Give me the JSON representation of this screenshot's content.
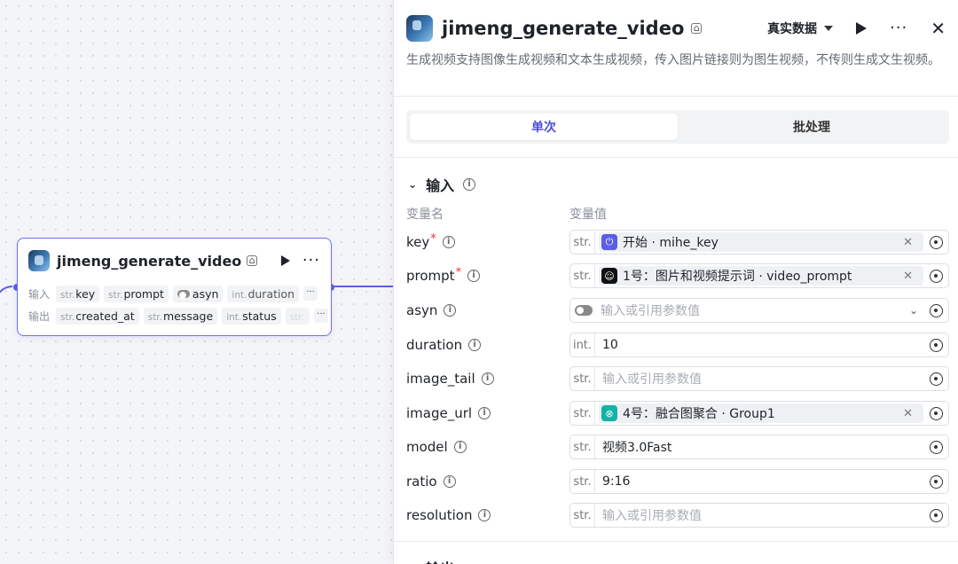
{
  "node": {
    "title": "jimeng_generate_video",
    "inputs_label": "输入",
    "outputs_label": "输出",
    "inputs": [
      {
        "type": "str.",
        "name": "key"
      },
      {
        "type": "str.",
        "name": "prompt"
      },
      {
        "type": "toggle",
        "name": "asyn"
      },
      {
        "type": "int.",
        "name": "duration"
      }
    ],
    "outputs": [
      {
        "type": "str.",
        "name": "created_at"
      },
      {
        "type": "str.",
        "name": "message"
      },
      {
        "type": "int.",
        "name": "status"
      },
      {
        "type": "str.",
        "name": ""
      }
    ],
    "more": "···"
  },
  "panel": {
    "title": "jimeng_generate_video",
    "data_mode": "真实数据",
    "description": "生成视频支持图像生成视频和文本生成视频，传入图片链接则为图生视频，不传则生成文生视频。",
    "tabs": [
      "单次",
      "批处理"
    ],
    "input_section": "输入",
    "col_name": "变量名",
    "col_value": "变量值",
    "params": [
      {
        "name": "key",
        "required": true,
        "type": "str.",
        "kind": "ref",
        "ref_icon_color": "#5b5ee6",
        "ref_icon": "⏻",
        "ref_text": "开始 · mihe_key"
      },
      {
        "name": "prompt",
        "required": true,
        "type": "str.",
        "kind": "ref",
        "ref_icon_color": "#111111",
        "ref_icon": "☺",
        "ref_text": "1号：图片和视频提示词 · video_prompt"
      },
      {
        "name": "asyn",
        "required": false,
        "type": "toggle",
        "kind": "select",
        "placeholder": "输入或引用参数值"
      },
      {
        "name": "duration",
        "required": false,
        "type": "int.",
        "kind": "value",
        "value": "10"
      },
      {
        "name": "image_tail",
        "required": false,
        "type": "str.",
        "kind": "placeholder",
        "placeholder": "输入或引用参数值"
      },
      {
        "name": "image_url",
        "required": false,
        "type": "str.",
        "kind": "ref",
        "ref_icon_color": "#14b3a6",
        "ref_icon": "⊗",
        "ref_text": "4号：融合图聚合 · Group1"
      },
      {
        "name": "model",
        "required": false,
        "type": "str.",
        "kind": "value",
        "value": "视频3.0Fast"
      },
      {
        "name": "ratio",
        "required": false,
        "type": "str.",
        "kind": "value",
        "value": "9:16"
      },
      {
        "name": "resolution",
        "required": false,
        "type": "str.",
        "kind": "placeholder",
        "placeholder": "输入或引用参数值"
      }
    ],
    "output_section": "输出"
  },
  "colors": {
    "accent": "#5b5ee6",
    "active_tab_text": "#4c4fd9"
  }
}
